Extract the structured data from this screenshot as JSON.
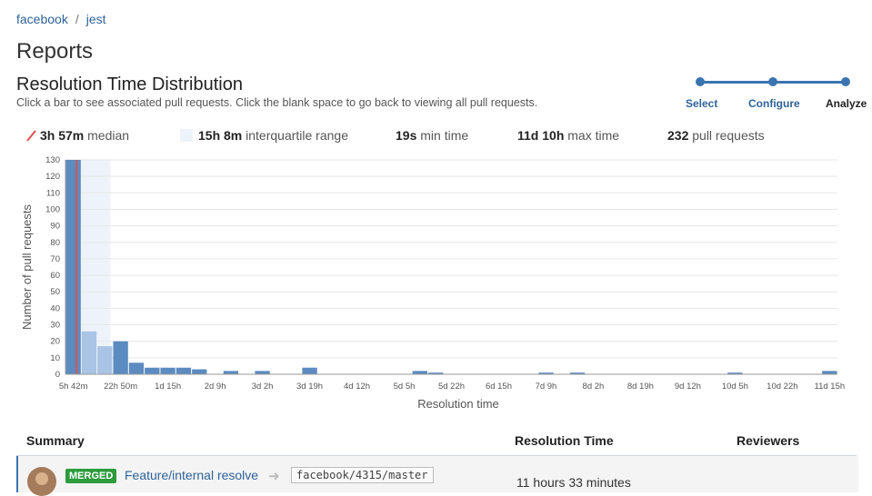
{
  "breadcrumb": {
    "org": "facebook",
    "separator": "/",
    "repo": "jest"
  },
  "page": {
    "title": "Reports"
  },
  "report": {
    "title": "Resolution Time Distribution",
    "description": "Click a bar to see associated pull requests. Click the blank space to go back to viewing all pull requests."
  },
  "wizard": {
    "steps": [
      "Select",
      "Configure",
      "Analyze"
    ],
    "active": "Analyze"
  },
  "stats": {
    "median_value": "3h 57m",
    "median_label": "median",
    "iqr_value": "15h 8m",
    "iqr_label": "interquartile range",
    "min_value": "19s",
    "min_label": "min time",
    "max_value": "11d 10h",
    "max_label": "max time",
    "count_value": "232",
    "count_label": "pull requests"
  },
  "colors": {
    "bar": "#5b8bc0",
    "bar_iqr": "#a9c4e4",
    "iqr_band": "#eef3fb",
    "median": "#d9534f",
    "link": "#2e6399"
  },
  "chart_data": {
    "type": "bar",
    "xlabel": "Resolution time",
    "ylabel": "Number of pull requests",
    "ylim": [
      0,
      130
    ],
    "yticks": [
      0,
      10,
      20,
      30,
      40,
      50,
      60,
      70,
      80,
      90,
      100,
      110,
      120,
      130
    ],
    "xtick_labels": [
      "5h 42m",
      "22h 50m",
      "1d 15h",
      "2d 9h",
      "3d 2h",
      "3d 19h",
      "4d 12h",
      "5d 5h",
      "5d 22h",
      "6d 15h",
      "7d 9h",
      "8d 2h",
      "8d 19h",
      "9d 12h",
      "10d 5h",
      "10d 22h",
      "11d 15h"
    ],
    "bin_count": 49,
    "values": [
      130,
      26,
      17,
      20,
      7,
      4,
      4,
      4,
      3,
      0,
      2,
      0,
      2,
      0,
      0,
      4,
      0,
      0,
      0,
      0,
      0,
      0,
      2,
      1,
      0,
      0,
      0,
      0,
      0,
      0,
      1,
      0,
      1,
      0,
      0,
      0,
      0,
      0,
      0,
      0,
      0,
      0,
      1,
      0,
      0,
      0,
      0,
      0,
      2
    ],
    "iqr_bins": [
      1,
      2
    ],
    "median_bin_fraction": 0.7,
    "iqr_end_bin_fraction": 2.85,
    "grid": true
  },
  "summary": {
    "headers": {
      "summary": "Summary",
      "resolution_time": "Resolution Time",
      "reviewers": "Reviewers"
    },
    "rows": [
      {
        "status": "MERGED",
        "title": "Feature/internal resolve",
        "branch": "facebook/4315/master",
        "resolution_time": "11 hours 33 minutes"
      }
    ]
  }
}
